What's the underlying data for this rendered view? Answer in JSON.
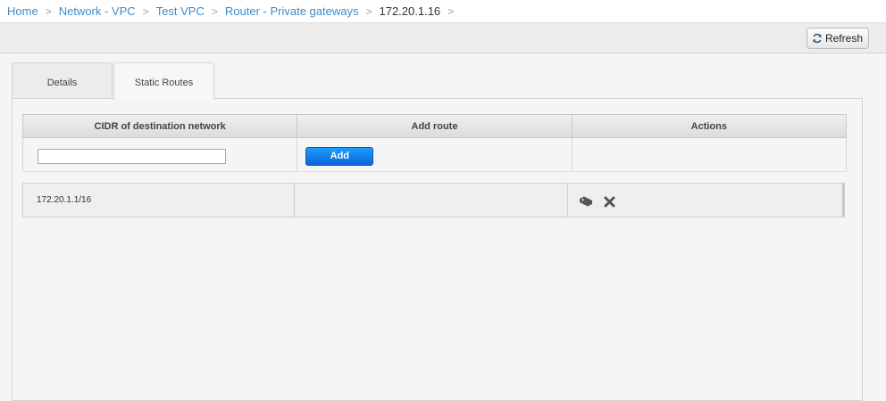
{
  "breadcrumb": {
    "items": [
      "Home",
      "Network - VPC",
      "Test VPC",
      "Router - Private gateways"
    ],
    "current": "172.20.1.16",
    "separator": ">"
  },
  "toolbar": {
    "refresh_label": "Refresh",
    "refresh_icon": "refresh-icon"
  },
  "tabs": [
    {
      "label": "Details",
      "active": false
    },
    {
      "label": "Static Routes",
      "active": true
    }
  ],
  "static_routes": {
    "columns": [
      "CIDR of destination network",
      "Add route",
      "Actions"
    ],
    "cidr_input": {
      "value": "",
      "placeholder": ""
    },
    "add_label": "Add",
    "rows": [
      {
        "cidr": "172.20.1.1/16",
        "actions": [
          "tag-icon",
          "remove-icon"
        ]
      }
    ]
  },
  "colors": {
    "link": "#3f8bc8",
    "add_button": "#0a63d6",
    "background": "#f5f5f5"
  }
}
